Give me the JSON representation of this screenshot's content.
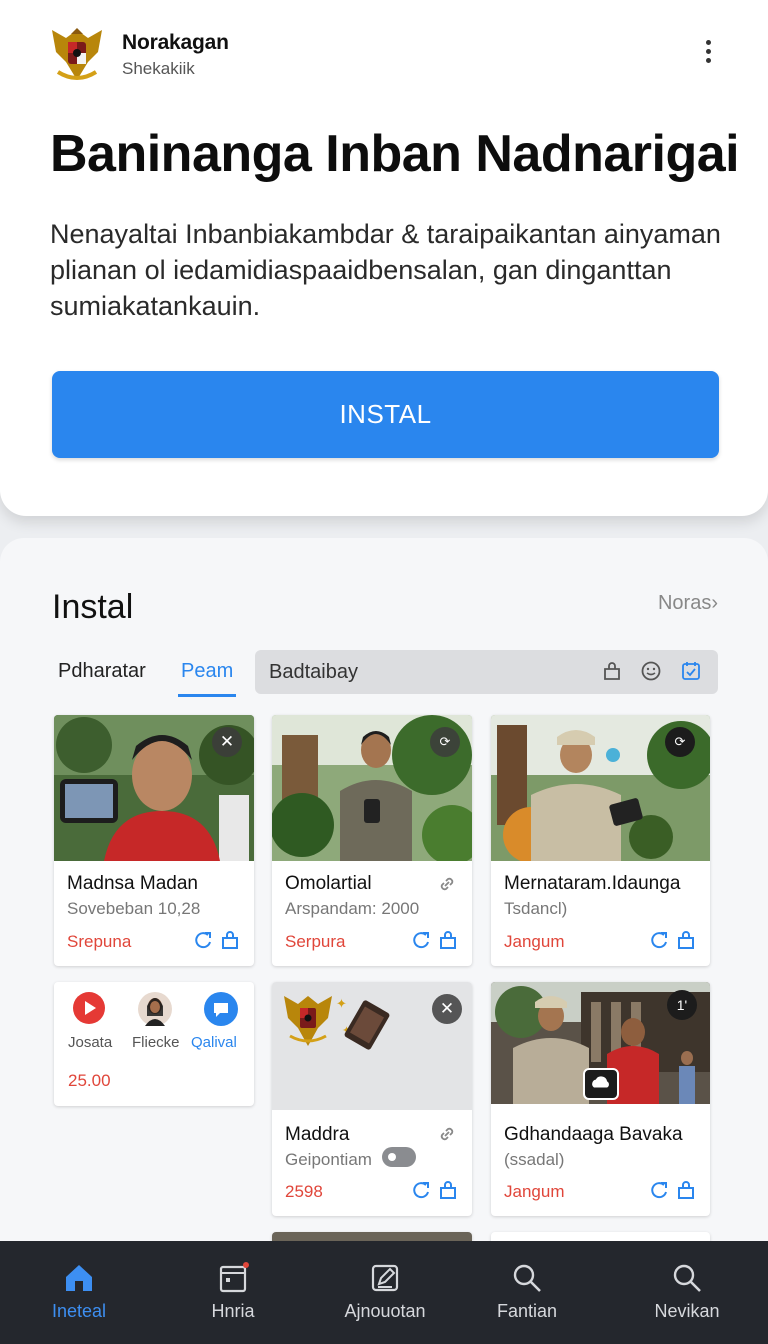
{
  "app": {
    "name": "Norakagan",
    "subtitle": "Shekakiik",
    "logo_icon": "garuda-emblem"
  },
  "hero": {
    "title": "Baninanga Inban Nadnarigai",
    "description": "Nenayaltai Inbanbiakambdar & taraipaikantan ainyaman plianan ol iedamidiaspaaidbensalan, gan dinganttan sumiakatankauin.",
    "install_label": "INSTAL"
  },
  "section": {
    "title": "Instal",
    "more_label": "Noras›"
  },
  "tabs": [
    {
      "label": "Pdharatar",
      "active": false
    },
    {
      "label": "Peam",
      "active": true
    }
  ],
  "filter": {
    "value": "Badtaibay",
    "icons": [
      "bag-icon",
      "emoji-icon",
      "calendar-check-icon"
    ]
  },
  "cards": [
    {
      "title": "Madnsa Madan",
      "subtitle": "Sovebeban 10,28",
      "status": "Srepuna"
    },
    {
      "title": "Omolartial",
      "subtitle": "Arspandam: 2000",
      "status": "Serpura"
    },
    {
      "title": "Mernataram.Idaunga",
      "subtitle": "Tsdancl)",
      "status": "Jangum"
    },
    {
      "labels": [
        "Josata",
        "Fliecke",
        "Qalival"
      ],
      "price": "25.00",
      "icons": [
        "play-icon",
        "avatar",
        "chat-icon"
      ]
    },
    {
      "title": "Maddra",
      "subtitle": "Geipontiam",
      "status": "2598"
    },
    {
      "title": "Gdhandaaga Bavaka",
      "subtitle": "(ssadal)",
      "status": "Jangum",
      "badge": "1'"
    }
  ],
  "bottom_nav": [
    {
      "label": "Ineteal",
      "icon": "home-icon",
      "active": true
    },
    {
      "label": "Hnria",
      "icon": "calendar-icon",
      "active": false
    },
    {
      "label": "Ajnouotan",
      "icon": "edit-icon",
      "active": false
    },
    {
      "label": "Fantian",
      "icon": "search-icon",
      "active": false
    },
    {
      "label": "Nevikan",
      "icon": "search-icon",
      "active": false
    }
  ],
  "colors": {
    "accent": "#2a86ee",
    "red": "#e0463a",
    "nav_bg": "#24272d"
  }
}
